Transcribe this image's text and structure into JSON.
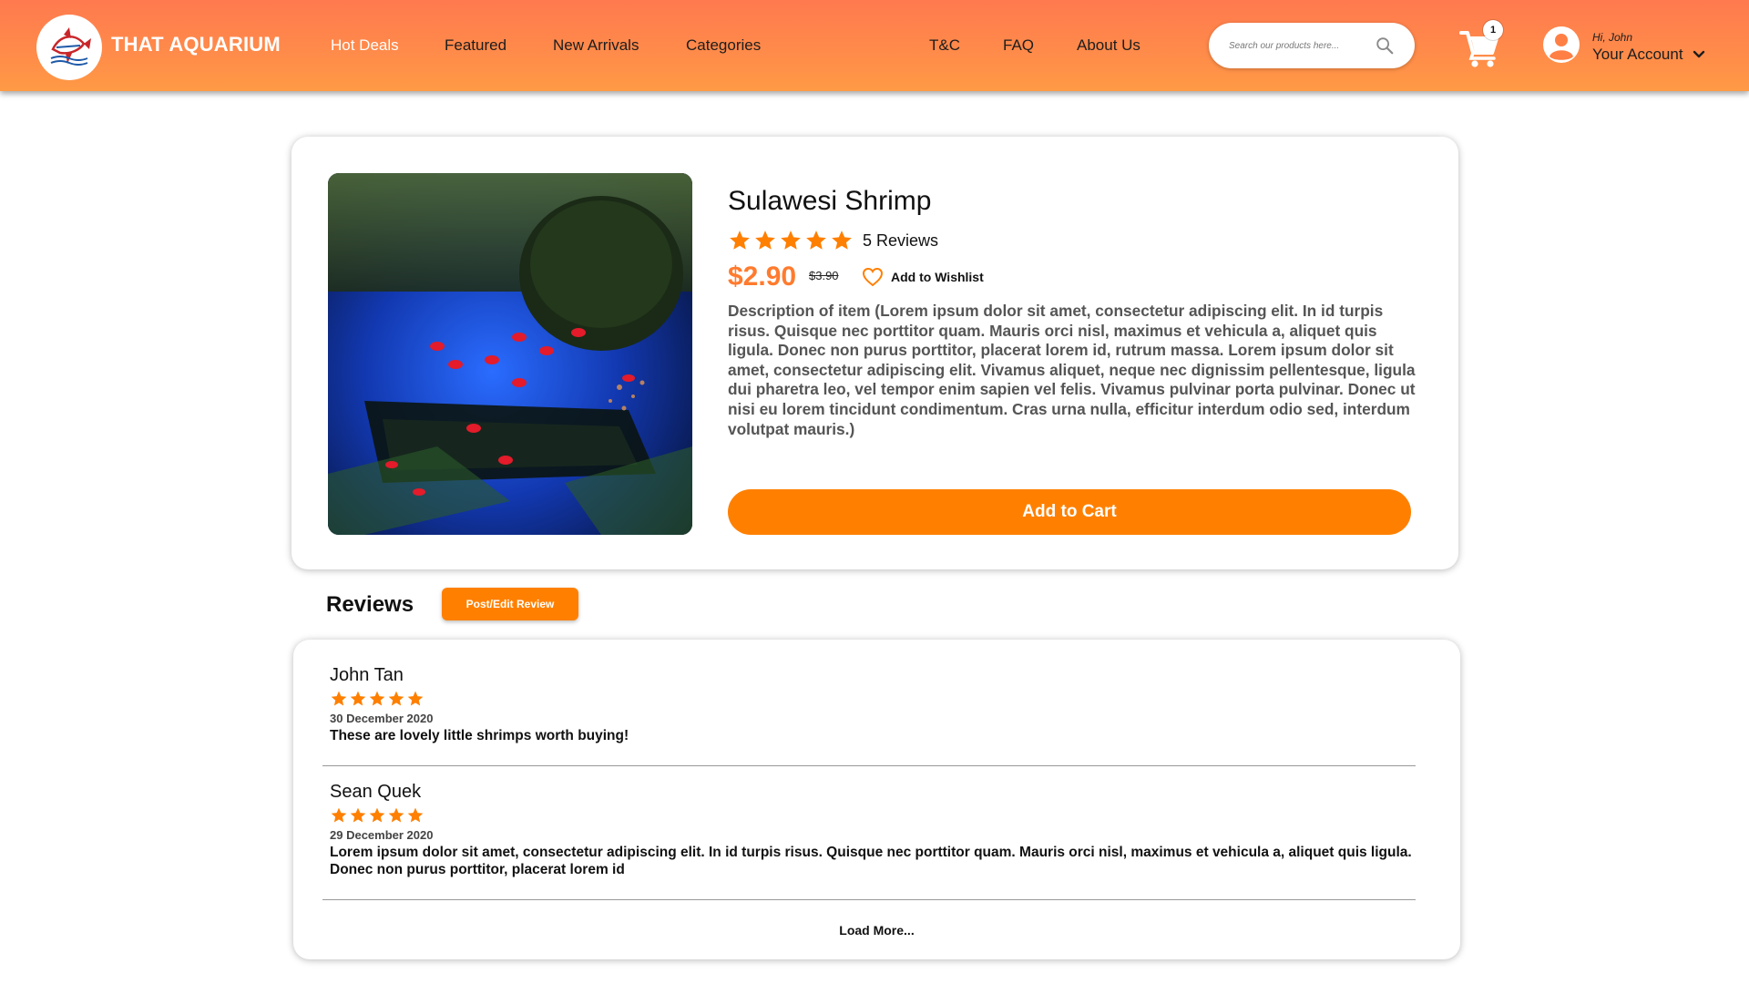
{
  "brand": {
    "name": "THAT AQUARIUM",
    "logo_icon": "angelfish-logo-icon"
  },
  "nav": {
    "left": [
      "Hot Deals",
      "Featured",
      "New Arrivals",
      "Categories"
    ],
    "right": [
      "T&C",
      "FAQ",
      "About Us"
    ],
    "active": "Hot Deals"
  },
  "search": {
    "placeholder": "Search our products here...",
    "value": "",
    "icon": "search-icon"
  },
  "cart": {
    "icon": "shopping-cart-icon",
    "count": "1"
  },
  "account": {
    "greeting": "Hi, John",
    "label": "Your Account",
    "icon": "user-avatar-icon"
  },
  "product": {
    "title": "Sulawesi Shrimp",
    "rating": 5,
    "rating_max": 5,
    "reviews_label": "5 Reviews",
    "price": "$2.90",
    "old_price": "$3.90",
    "wishlist_label": "Add to Wishlist",
    "description": "Description of item (Lorem ipsum dolor sit amet, consectetur adipiscing elit. In id turpis risus. Quisque nec porttitor quam. Mauris orci nisl, maximus et vehicula a, aliquet quis ligula. Donec non purus porttitor, placerat lorem id, rutrum massa. Lorem ipsum dolor sit amet, consectetur adipiscing elit. Vivamus aliquet, neque nec dignissim pellentesque, ligula dui pharetra leo, vel tempor enim sapien vel felis. Vivamus pulvinar porta pulvinar. Donec ut nisi eu lorem tincidunt condimentum. Cras urna nulla, efficitur interdum odio sed, interdum volutpat mauris.)",
    "add_to_cart_label": "Add to Cart"
  },
  "reviews": {
    "heading": "Reviews",
    "post_button": "Post/Edit Review",
    "items": [
      {
        "name": "John Tan",
        "rating": 5,
        "date": "30 December 2020",
        "text": "These are lovely little shrimps worth buying!"
      },
      {
        "name": "Sean Quek",
        "rating": 5,
        "date": "29 December 2020",
        "text": "Lorem ipsum dolor sit amet, consectetur adipiscing elit. In id turpis risus. Quisque nec porttitor quam. Mauris orci nisl, maximus et vehicula a, aliquet quis ligula. Donec non purus porttitor, placerat lorem id"
      }
    ],
    "load_more": "Load More..."
  },
  "colors": {
    "header_start": "#ff7a4f",
    "header_end": "#ff9a45",
    "accent": "#ff8000",
    "price": "#ff7b2e",
    "star": "#ff7f00"
  }
}
